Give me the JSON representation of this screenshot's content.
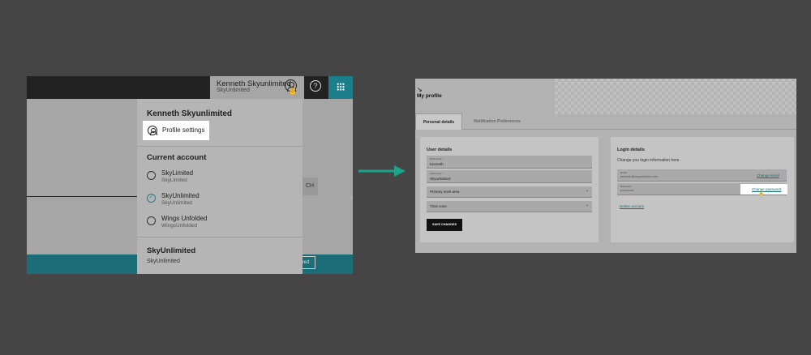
{
  "left_screen": {
    "user": {
      "name": "Kenneth Skyunlimited",
      "org": "SkyUnlimited"
    },
    "help_glyph": "?",
    "background": {
      "search_button_partial": "CH",
      "bottom_button_partial": "red"
    },
    "dropdown": {
      "title": "Kenneth Skyunlimited",
      "profile_settings_label": "Profile settings",
      "current_account_heading": "Current account",
      "accounts": [
        {
          "name": "SkyLimited",
          "sub": "SkyLimited",
          "selected": false
        },
        {
          "name": "SkyUnlimited",
          "sub": "SkyUnlimited",
          "selected": true
        },
        {
          "name": "Wings Unfolded",
          "sub": "WingsUnfolded",
          "selected": false
        }
      ],
      "footer_title": "SkyUnlimited",
      "footer_sub": "SkyUnlimited"
    },
    "colors": {
      "topbar": "#222222",
      "accent": "#1b7e8a",
      "highlight": "#ffffff"
    }
  },
  "arrow": {
    "color": "#1aa58c"
  },
  "right_screen": {
    "back_icon": "↘",
    "page_title": "My profile",
    "tabs": [
      "Personal details",
      "Notification Preferences"
    ],
    "active_tab": "Personal details",
    "user_details": {
      "title": "User details",
      "first_name": {
        "label": "First name *",
        "value": "Kenneth"
      },
      "last_name": {
        "label": "Last name *",
        "value": "Skyunlimited"
      },
      "work_area": "Primary work area",
      "time_zone": "Time zone",
      "save_label": "SAVE CHANGES"
    },
    "login_details": {
      "title": "Login details",
      "description": "Change you login information here.",
      "email": {
        "label": "Email",
        "value": "kenneth@skyunlimited.com",
        "link": "Change email"
      },
      "password": {
        "label": "Password",
        "value": "password",
        "link": "Change password"
      },
      "delete_link": "Delete account"
    }
  }
}
